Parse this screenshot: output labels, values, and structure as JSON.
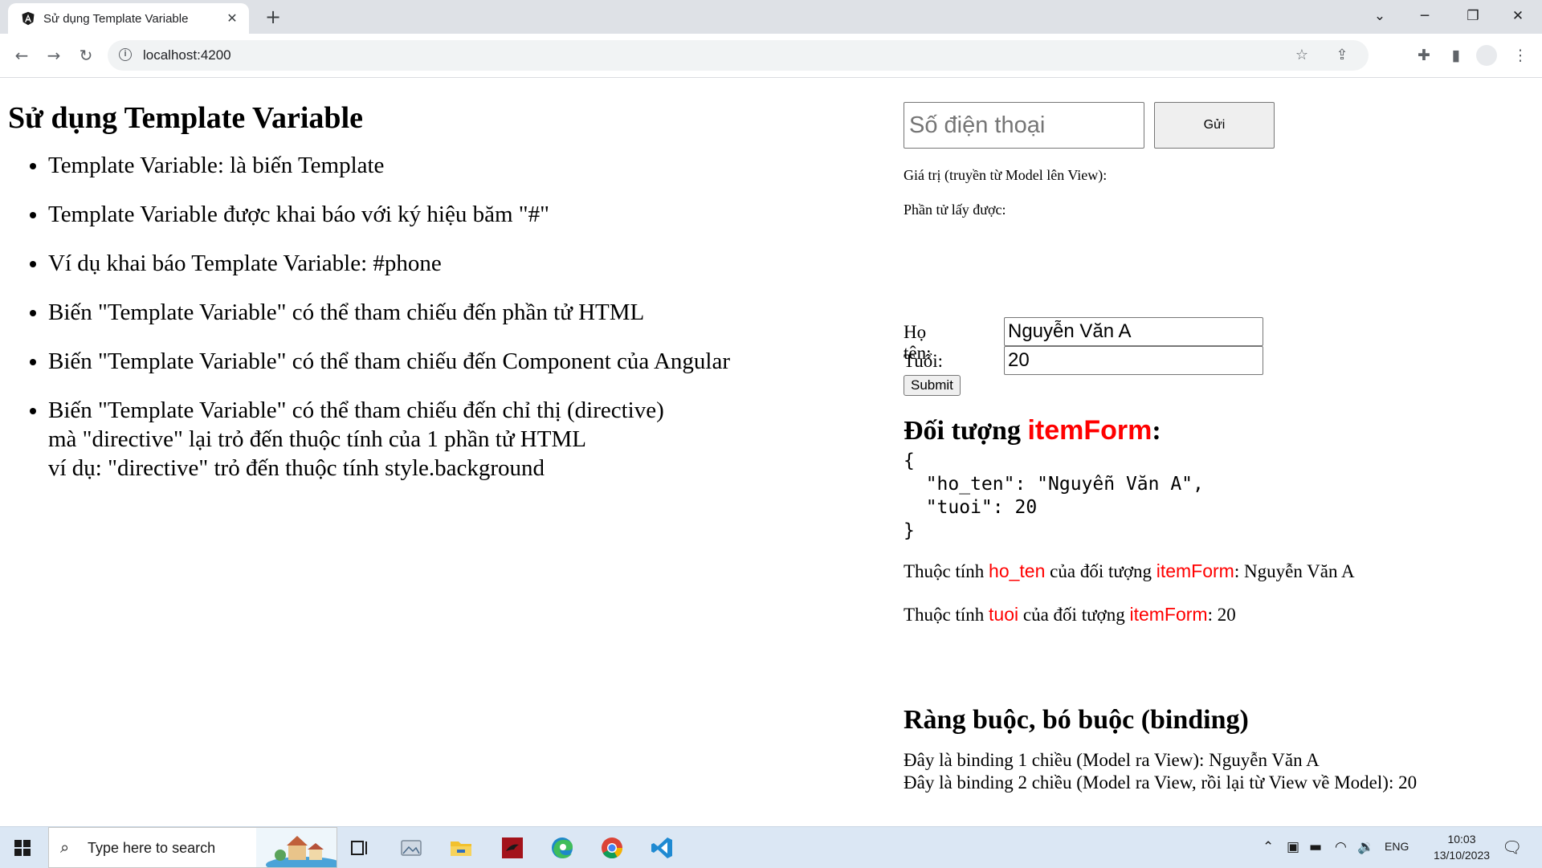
{
  "browser": {
    "tab_title": "Sử dụng Template Variable",
    "url": "localhost:4200",
    "brand_color": "#dd0031"
  },
  "page": {
    "title": "Sử dụng Template Variable",
    "bullets": [
      {
        "lines": [
          "Template Variable: là biến Template"
        ]
      },
      {
        "lines": [
          "Template Variable được khai báo với ký hiệu băm \"#\""
        ]
      },
      {
        "lines": [
          "Ví dụ khai báo Template Variable: #phone"
        ]
      },
      {
        "lines": [
          "Biến \"Template Variable\" có thể tham chiếu đến phần tử HTML"
        ]
      },
      {
        "lines": [
          "Biến \"Template Variable\" có thể tham chiếu đến Component của Angular"
        ]
      },
      {
        "lines": [
          "Biến \"Template Variable\" có thể tham chiếu đến chỉ thị (directive)",
          "mà \"directive\" lại trỏ đến thuộc tính của 1 phần tử HTML",
          "ví dụ: \"directive\" trỏ đến thuộc tính style.background"
        ]
      }
    ]
  },
  "phone": {
    "placeholder": "Số điện thoại",
    "send_label": "Gửi",
    "value_label": "Giá trị (truyền từ Model lên View):",
    "element_label": "Phần tử lấy được:"
  },
  "form": {
    "name_label": "Họ tên:",
    "name_value": "Nguyễn Văn A",
    "age_label": "Tuổi:",
    "age_value": "20",
    "submit_label": "Submit"
  },
  "item_form": {
    "heading_prefix": "Đối tượng ",
    "heading_name": "itemForm",
    "heading_suffix": ":",
    "json_text": "{\n  \"ho_ten\": \"Nguyễn Văn A\",\n  \"tuoi\": 20\n}",
    "prop_prefix": "Thuộc tính ",
    "prop_middle": " của đối tượng ",
    "prop_name_1": "ho_ten",
    "prop_value_1": ": Nguyễn Văn A",
    "prop_name_2": "tuoi",
    "prop_value_2": ": 20",
    "highlight_color": "#ff0000"
  },
  "binding": {
    "title": "Ràng buộc, bó buộc (binding)",
    "one_way": "Đây là binding 1 chiều (Model ra View): Nguyễn Văn A",
    "two_way": "Đây là binding 2 chiều (Model ra View, rồi lại từ View về Model): 20"
  },
  "taskbar": {
    "search_placeholder": "Type here to search",
    "language": "ENG",
    "time": "10:03",
    "date": "13/10/2023",
    "apps": [
      "task-view-icon",
      "photos-icon",
      "file-explorer-icon",
      "app-icon",
      "edge-icon",
      "chrome-icon",
      "vscode-icon"
    ]
  }
}
